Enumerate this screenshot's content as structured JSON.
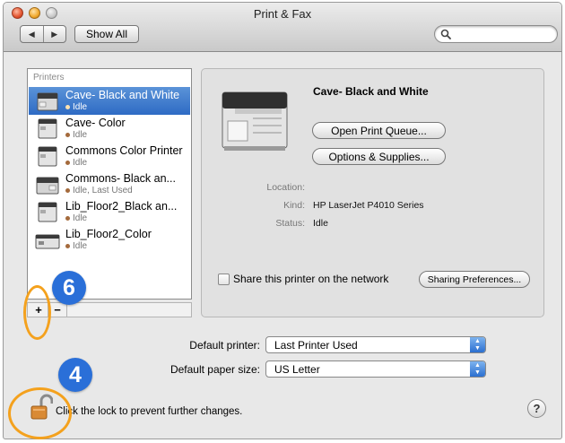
{
  "window": {
    "title": "Print & Fax"
  },
  "toolbar": {
    "back_icon": "back-arrow-icon",
    "forward_icon": "forward-arrow-icon",
    "back_glyph": "◀",
    "forward_glyph": "▶",
    "show_all_label": "Show All",
    "search_placeholder": "",
    "search_icon": "magnifier-icon"
  },
  "printers": {
    "header": "Printers",
    "items": [
      {
        "name": "Cave- Black and White",
        "status": "Idle",
        "selected": true
      },
      {
        "name": "Cave- Color",
        "status": "Idle",
        "selected": false
      },
      {
        "name": "Commons Color Printer",
        "status": "Idle",
        "selected": false
      },
      {
        "name": "Commons- Black an...",
        "status": "Idle, Last Used",
        "selected": false
      },
      {
        "name": "Lib_Floor2_Black an...",
        "status": "Idle",
        "selected": false
      },
      {
        "name": "Lib_Floor2_Color",
        "status": "Idle",
        "selected": false
      }
    ],
    "add_label": "+",
    "remove_label": "−"
  },
  "detail": {
    "name": "Cave- Black and White",
    "open_queue_label": "Open Print Queue...",
    "options_label": "Options & Supplies...",
    "location_label": "Location:",
    "location_value": "",
    "kind_label": "Kind:",
    "kind_value": "HP LaserJet P4010 Series",
    "status_label": "Status:",
    "status_value": "Idle",
    "share_label": "Share this printer on the network",
    "share_checked": false,
    "sharing_prefs_label": "Sharing Preferences..."
  },
  "defaults": {
    "printer_label": "Default printer:",
    "printer_value": "Last Printer Used",
    "paper_label": "Default paper size:",
    "paper_value": "US Letter"
  },
  "footer": {
    "lock_message": "Click the lock to prevent further changes.",
    "help_label": "?"
  },
  "annotations": {
    "badge_add": "6",
    "badge_lock": "4",
    "badge_color": "#2a6fd8",
    "ring_color": "#f4a11d"
  },
  "colors": {
    "selection": "#2e6bc4",
    "window_bg": "#e8e8e8"
  }
}
